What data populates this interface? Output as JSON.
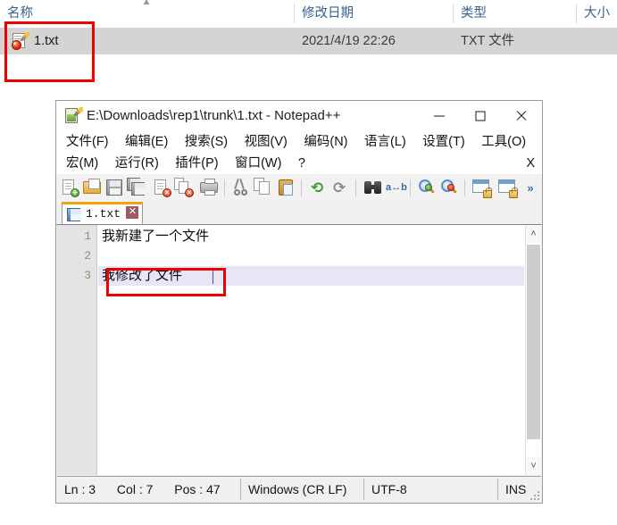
{
  "explorer": {
    "columns": [
      {
        "label": "名称"
      },
      {
        "label": "修改日期"
      },
      {
        "label": "类型"
      },
      {
        "label": "大小"
      }
    ],
    "sort_indicator": "▲",
    "rows": [
      {
        "icon": "notepadpp-document-icon",
        "name": "1.txt",
        "modified": "2021/4/19 22:26",
        "type": "TXT 文件",
        "size": ""
      }
    ],
    "annotation_color": "#ef0000"
  },
  "notepad": {
    "title": "E:\\Downloads\\rep1\\trunk\\1.txt - Notepad++",
    "title_icon": "notepadpp-app-icon",
    "window_controls": {
      "minimize": "minimize-icon",
      "maximize": "maximize-icon",
      "close": "close-icon"
    },
    "menu_row_1": [
      {
        "label": "文件(F)"
      },
      {
        "label": "编辑(E)"
      },
      {
        "label": "搜索(S)"
      },
      {
        "label": "视图(V)"
      },
      {
        "label": "编码(N)"
      },
      {
        "label": "语言(L)"
      },
      {
        "label": "设置(T)"
      },
      {
        "label": "工具(O)"
      }
    ],
    "menu_row_2": [
      {
        "label": "宏(M)"
      },
      {
        "label": "运行(R)"
      },
      {
        "label": "插件(P)"
      },
      {
        "label": "窗口(W)"
      },
      {
        "label": "?"
      }
    ],
    "menu_close_doc": "X",
    "toolbar": {
      "overflow_label": "»",
      "buttons": [
        {
          "name": "new-file-icon"
        },
        {
          "name": "open-file-icon"
        },
        {
          "name": "save-icon"
        },
        {
          "name": "save-all-icon"
        },
        {
          "name": "close-file-icon"
        },
        {
          "name": "close-all-files-icon"
        },
        {
          "name": "print-icon"
        },
        {
          "name": "cut-icon"
        },
        {
          "name": "copy-icon"
        },
        {
          "name": "paste-icon"
        },
        {
          "name": "undo-icon"
        },
        {
          "name": "redo-icon"
        },
        {
          "name": "find-icon"
        },
        {
          "name": "replace-icon"
        },
        {
          "name": "zoom-in-icon"
        },
        {
          "name": "zoom-out-icon"
        },
        {
          "name": "sync-vertical-scroll-icon"
        },
        {
          "name": "sync-horizontal-scroll-icon"
        }
      ]
    },
    "tabs": [
      {
        "label": "1.txt",
        "icon": "saved-file-icon",
        "close_label": "✕",
        "active": true,
        "accent": "#f0a30a"
      }
    ],
    "editor": {
      "line_numbers": [
        "1",
        "2",
        "3"
      ],
      "lines": [
        {
          "text": "我新建了一个文件",
          "current": false
        },
        {
          "text": "",
          "current": false
        },
        {
          "text": "我修改了文件",
          "current": true
        }
      ],
      "current_line_highlight": "#e6e6f7",
      "caret_color": "#6b3fb0",
      "scrollbar": {
        "up": "˄",
        "down": "˅"
      }
    },
    "status_bar": {
      "ln_label": "Ln : 3",
      "col_label": "Col : 7",
      "pos_label": "Pos : 47",
      "eol": "Windows (CR LF)",
      "encoding": "UTF-8",
      "insert_mode": "INS"
    }
  }
}
